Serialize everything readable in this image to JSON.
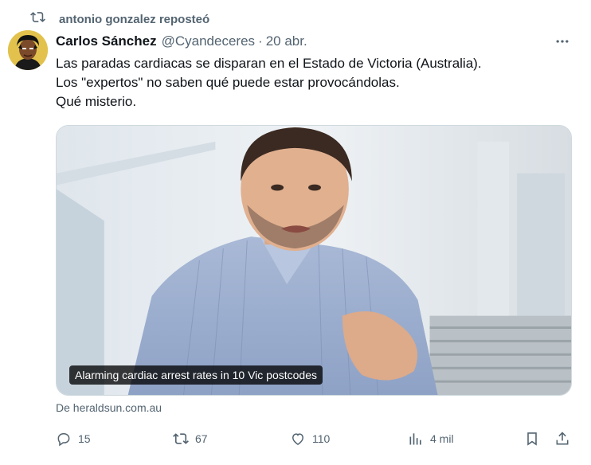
{
  "repost": {
    "label": "antonio gonzalez reposteó",
    "icon": "repost-icon"
  },
  "tweet": {
    "author_name": "Carlos Sánchez",
    "handle": "@Cyandeceres",
    "separator": "·",
    "date": "20 abr.",
    "text_lines": [
      "Las paradas cardiacas se disparan en el Estado de Victoria (Australia).",
      "Los \"expertos\" no saben qué puede estar provocándolas.",
      "Qué misterio."
    ],
    "card": {
      "caption": "Alarming cardiac arrest rates in 10 Vic postcodes",
      "source": "De heraldsun.com.au"
    },
    "actions": {
      "replies": "15",
      "reposts": "67",
      "likes": "110",
      "views": "4 mil"
    }
  },
  "colors": {
    "text_primary": "#0f1419",
    "text_secondary": "#536471",
    "border": "#cfd9de"
  }
}
